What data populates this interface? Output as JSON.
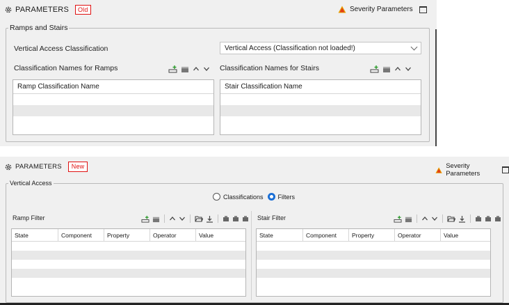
{
  "old": {
    "header": {
      "title": "PARAMETERS",
      "tag": "Old",
      "severity_label": "Severity Parameters"
    },
    "group_title": "Ramps and Stairs",
    "vertical_access_label": "Vertical Access Classification",
    "vertical_access_value": "Vertical Access (Classification not loaded!)",
    "ramps": {
      "label": "Classification Names for Ramps",
      "column": "Ramp Classification Name"
    },
    "stairs": {
      "label": "Classification Names for Stairs",
      "column": "Stair Classification Name"
    }
  },
  "new": {
    "header": {
      "title": "PARAMETERS",
      "tag": "New",
      "severity_label": "Severity Parameters"
    },
    "group_title": "Vertical Access",
    "mode": {
      "options": [
        "Classifications",
        "Filters"
      ],
      "selected": "Filters"
    },
    "ramp_filter": {
      "label": "Ramp Filter",
      "columns": [
        "State",
        "Component",
        "Property",
        "Operator",
        "Value"
      ]
    },
    "stair_filter": {
      "label": "Stair Filter",
      "columns": [
        "State",
        "Component",
        "Property",
        "Operator",
        "Value"
      ]
    }
  },
  "colors": {
    "accent": "#1a6fd6",
    "tag": "#e01010",
    "warning": "#e8a000"
  }
}
